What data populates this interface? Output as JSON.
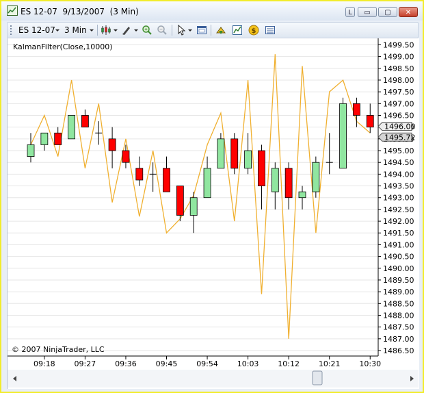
{
  "window": {
    "title": "ES 12-07  9/13/2007  (3 Min)",
    "btn_l": "L",
    "btn_min": "▭",
    "btn_max": "▢",
    "btn_close": "✕"
  },
  "toolbar": {
    "instrument": "ES 12-07",
    "interval": "3 Min"
  },
  "icons": {
    "app": "chart-window-icon",
    "bar_style": "candlestick-icon",
    "draw": "pencil-icon",
    "zoom_in": "zoom-in-icon",
    "zoom_out": "zoom-out-icon",
    "cursor": "cursor-arrow-icon",
    "properties": "chart-properties-icon",
    "strategies": "strategies-icon",
    "indicators": "indicators-icon",
    "money": "money-icon",
    "data_box": "data-box-icon"
  },
  "colors": {
    "up": "#90e6a0",
    "down": "#ff0000",
    "indicator": "#f0b030",
    "grid": "#e6e6e6"
  },
  "chart_data": {
    "type": "candlestick",
    "indicator_label": "KalmanFilter(Close,10000)",
    "copyright": "© 2007 NinjaTrader, LLC",
    "ylim": [
      1486.5,
      1499.6
    ],
    "yticks": [
      1486.5,
      1487.0,
      1487.5,
      1488.0,
      1488.5,
      1489.0,
      1489.5,
      1490.0,
      1490.5,
      1491.0,
      1491.5,
      1492.0,
      1492.5,
      1493.0,
      1493.5,
      1494.0,
      1494.5,
      1495.0,
      1495.5,
      1496.0,
      1496.5,
      1497.0,
      1497.5,
      1498.0,
      1498.5,
      1499.0,
      1499.5
    ],
    "xticks": [
      {
        "i": 1,
        "label": "09:18"
      },
      {
        "i": 4,
        "label": "09:27"
      },
      {
        "i": 7,
        "label": "09:36"
      },
      {
        "i": 10,
        "label": "09:45"
      },
      {
        "i": 13,
        "label": "09:54"
      },
      {
        "i": 16,
        "label": "10:03"
      },
      {
        "i": 19,
        "label": "10:12"
      },
      {
        "i": 22,
        "label": "10:21"
      },
      {
        "i": 25,
        "label": "10:30"
      }
    ],
    "candles": [
      {
        "o": 1494.75,
        "h": 1495.75,
        "l": 1494.5,
        "c": 1495.25
      },
      {
        "o": 1495.25,
        "h": 1495.75,
        "l": 1495.0,
        "c": 1495.75
      },
      {
        "o": 1495.75,
        "h": 1496.0,
        "l": 1495.25,
        "c": 1495.25
      },
      {
        "o": 1495.5,
        "h": 1496.5,
        "l": 1495.5,
        "c": 1496.5
      },
      {
        "o": 1496.5,
        "h": 1496.75,
        "l": 1496.0,
        "c": 1496.0
      },
      {
        "o": 1495.75,
        "h": 1496.25,
        "l": 1495.25,
        "c": 1495.75
      },
      {
        "o": 1495.5,
        "h": 1496.0,
        "l": 1494.25,
        "c": 1495.0
      },
      {
        "o": 1495.0,
        "h": 1495.25,
        "l": 1494.25,
        "c": 1494.5
      },
      {
        "o": 1494.25,
        "h": 1494.75,
        "l": 1493.5,
        "c": 1493.75
      },
      {
        "o": 1494.0,
        "h": 1494.5,
        "l": 1493.25,
        "c": 1494.0
      },
      {
        "o": 1494.25,
        "h": 1494.75,
        "l": 1493.25,
        "c": 1493.25
      },
      {
        "o": 1493.5,
        "h": 1493.5,
        "l": 1492.0,
        "c": 1492.25
      },
      {
        "o": 1492.25,
        "h": 1493.25,
        "l": 1491.5,
        "c": 1493.0
      },
      {
        "o": 1493.0,
        "h": 1494.75,
        "l": 1493.0,
        "c": 1494.25
      },
      {
        "o": 1494.25,
        "h": 1495.75,
        "l": 1494.25,
        "c": 1495.5
      },
      {
        "o": 1495.5,
        "h": 1495.75,
        "l": 1494.0,
        "c": 1494.25
      },
      {
        "o": 1494.25,
        "h": 1495.75,
        "l": 1494.0,
        "c": 1495.0
      },
      {
        "o": 1495.0,
        "h": 1495.25,
        "l": 1492.5,
        "c": 1493.5
      },
      {
        "o": 1493.25,
        "h": 1494.5,
        "l": 1492.5,
        "c": 1494.25
      },
      {
        "o": 1494.25,
        "h": 1494.5,
        "l": 1492.5,
        "c": 1493.0
      },
      {
        "o": 1493.0,
        "h": 1493.5,
        "l": 1492.5,
        "c": 1493.25
      },
      {
        "o": 1493.25,
        "h": 1494.75,
        "l": 1493.0,
        "c": 1494.5
      },
      {
        "o": 1494.5,
        "h": 1495.75,
        "l": 1494.0,
        "c": 1494.5
      },
      {
        "o": 1494.25,
        "h": 1497.25,
        "l": 1494.25,
        "c": 1497.0
      },
      {
        "o": 1497.0,
        "h": 1497.25,
        "l": 1496.0,
        "c": 1496.5
      },
      {
        "o": 1496.5,
        "h": 1497.0,
        "l": 1495.75,
        "c": 1496.0
      }
    ],
    "kalman": [
      1495.25,
      1496.5,
      1494.75,
      1498.0,
      1494.25,
      1497.0,
      1492.8,
      1495.5,
      1492.2,
      1495.0,
      1491.5,
      1492.1,
      1493.1,
      1495.25,
      1496.6,
      1492.0,
      1498.0,
      1488.9,
      1499.1,
      1487.0,
      1498.6,
      1491.5,
      1497.5,
      1498.0,
      1496.25,
      1495.75
    ],
    "price_markers": [
      {
        "value": 1496.0,
        "label": "1496.00"
      },
      {
        "value": 1495.75,
        "label": "1495.72"
      }
    ]
  }
}
